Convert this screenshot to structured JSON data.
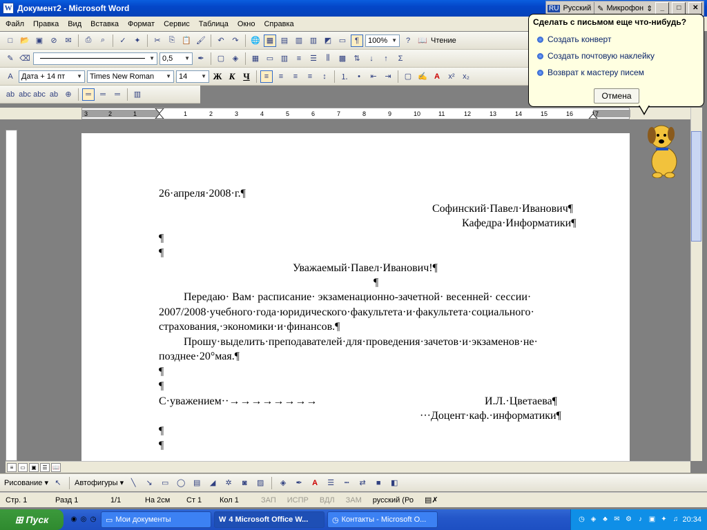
{
  "window": {
    "title": "Документ2 - Microsoft Word"
  },
  "langbar": {
    "code": "RU",
    "language": "Русский",
    "mic": "Микрофон"
  },
  "menu": [
    "Файл",
    "Правка",
    "Вид",
    "Вставка",
    "Формат",
    "Сервис",
    "Таблица",
    "Окно",
    "Справка"
  ],
  "toolbar": {
    "zoom": "100%",
    "reading": "Чтение",
    "line_weight": "0,5"
  },
  "format": {
    "style": "Дата + 14 пт",
    "font": "Times New Roman",
    "size": "14",
    "bold": "Ж",
    "italic": "К",
    "underline": "Ч"
  },
  "assistant": {
    "title": "Сделать с письмом еще что-нибудь?",
    "options": [
      "Создать конверт",
      "Создать почтовую наклейку",
      "Возврат к мастеру писем"
    ],
    "cancel": "Отмена"
  },
  "ruler": {
    "h_ticks": [
      "3",
      "2",
      "1",
      "1",
      "2",
      "3",
      "4",
      "5",
      "6",
      "7",
      "8",
      "9",
      "10",
      "11",
      "12",
      "13",
      "14",
      "15",
      "16",
      "17"
    ]
  },
  "document": {
    "date": "26·апреля·2008·г.¶",
    "recipient_name": "Софинский·Павел·Иванович¶",
    "recipient_dept": "Кафедра·Информатики¶",
    "blank": "¶",
    "salutation": "Уважаемый·Павел·Иванович!¶",
    "p1_line1": "Передаю· Вам· расписание· экзаменационно-зачетной· весенней· сессии·",
    "p1_line2": "2007/2008·учебного·года·юридического·факультета·и·факультета·социального·",
    "p1_line3": "страхования,·экономики·и·финансов.¶",
    "p2_line1": "Прошу·выделить·преподавателей·для·проведения·зачетов·и·экзаменов·не·",
    "p2_line2": "позднее·20°мая.¶",
    "closing": "С·уважением··→→→→→→→→",
    "signer": "И.Л.·Цветаева¶",
    "signer_title": "···Доцент·каф.·информатики¶"
  },
  "drawing": {
    "draw": "Рисование ▾",
    "autoshapes": "Автофигуры ▾"
  },
  "status": {
    "page": "Стр.  1",
    "section": "Разд  1",
    "pages": "1/1",
    "at": "На  2см",
    "line": "Ст  1",
    "col": "Кол  1",
    "rec": "ЗАП",
    "trk": "ИСПР",
    "ext": "ВДЛ",
    "ovr": "ЗАМ",
    "lang": "русский (Ро"
  },
  "taskbar": {
    "start": "Пуск",
    "items": [
      "Мои документы",
      "4 Microsoft Office W...",
      "Контакты - Microsoft O..."
    ],
    "clock": "20:34"
  }
}
